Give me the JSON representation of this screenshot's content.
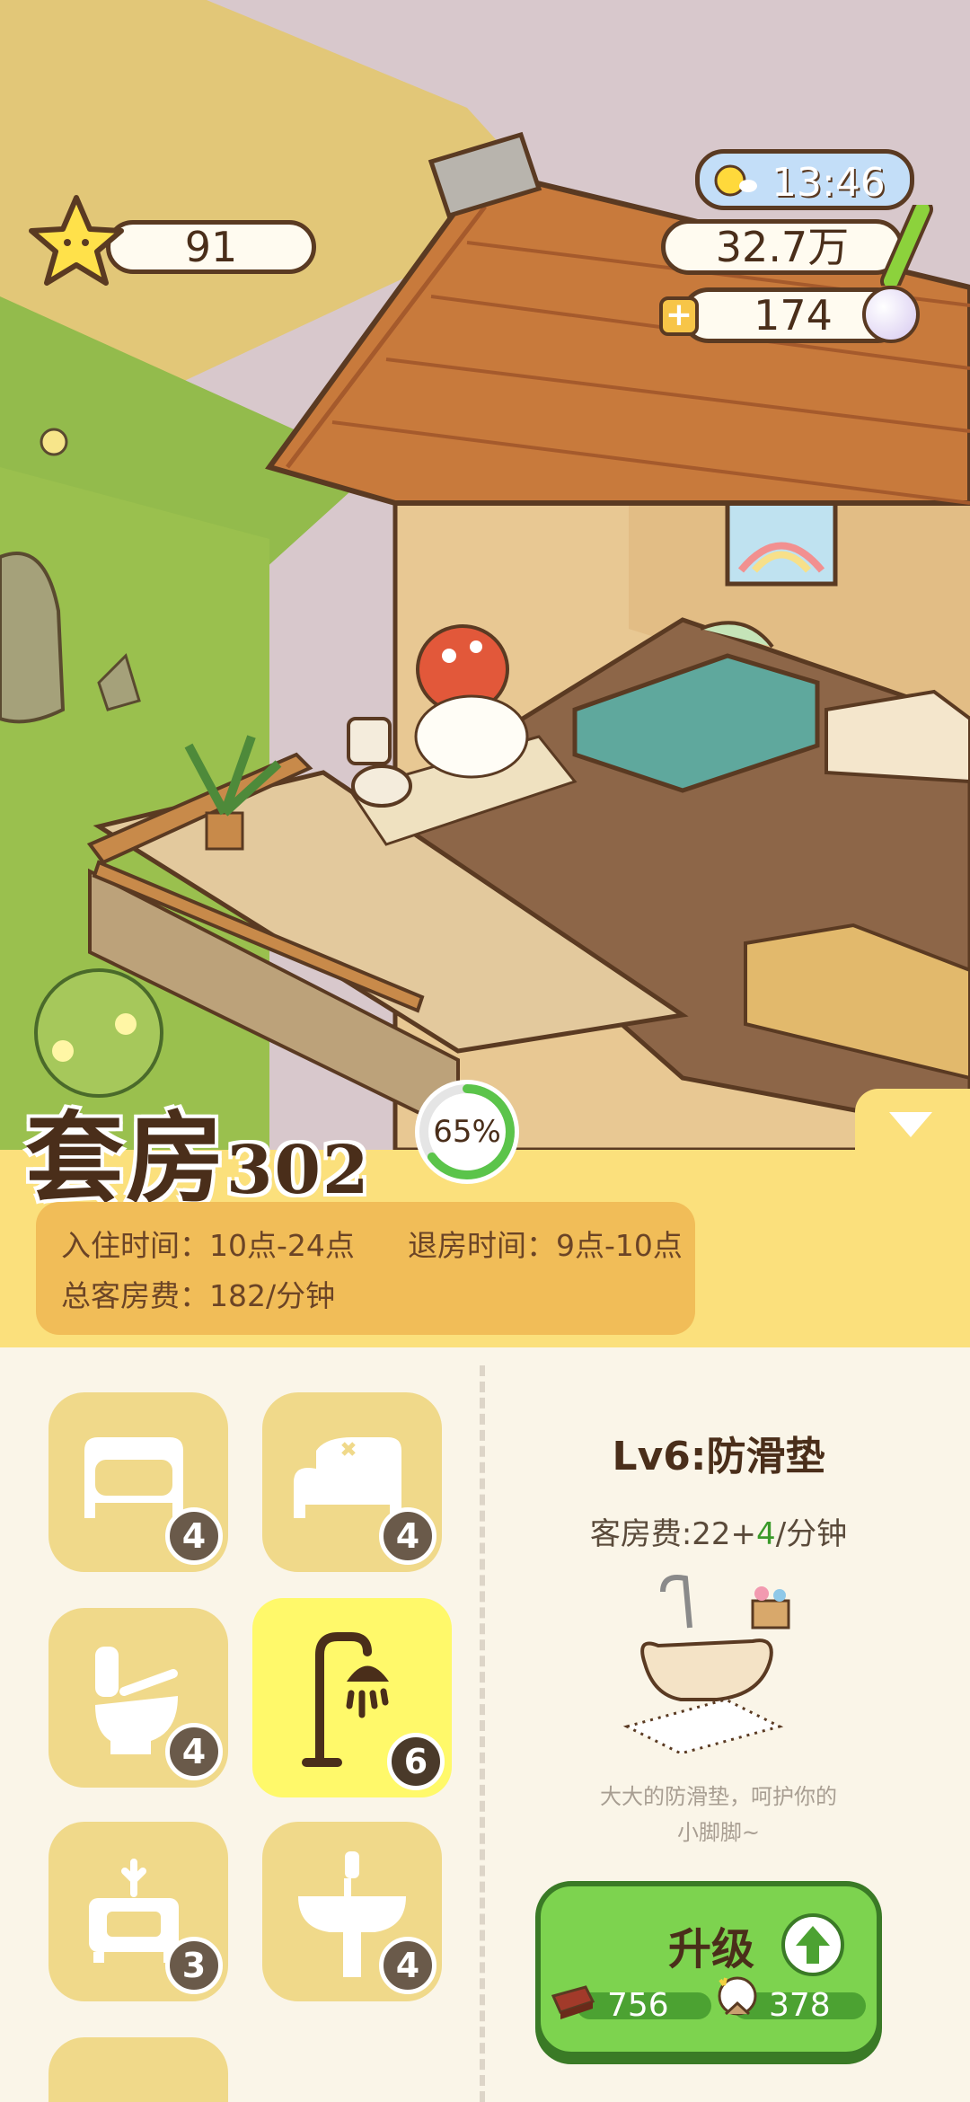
{
  "hud": {
    "weather_time": "13:46",
    "stars": "91",
    "bamboo": "32.7万",
    "pearls": "174"
  },
  "room": {
    "name_main": "套房",
    "name_num": "302",
    "progress_percent": 65,
    "progress_label": "65%",
    "checkin": "入住时间：10点-24点",
    "checkout": "退房时间：9点-10点",
    "total_fee": "总客房费：182/分钟"
  },
  "furniture_tiles": [
    {
      "icon": "bed-icon",
      "level": "4"
    },
    {
      "icon": "sofa-bed-icon",
      "level": "4"
    },
    {
      "icon": "toilet-icon",
      "level": "4"
    },
    {
      "icon": "shower-icon",
      "level": "6",
      "selected": true
    },
    {
      "icon": "nightstand-icon",
      "level": "3"
    },
    {
      "icon": "sink-icon",
      "level": "4"
    }
  ],
  "detail": {
    "title": "Lv6:防滑垫",
    "fee_prefix": "客房费:22+",
    "fee_plus": "4",
    "fee_suffix": "/分钟",
    "desc_line1": "大大的防滑垫，呵护你的",
    "desc_line2": "小脚脚~"
  },
  "upgrade": {
    "label": "升级",
    "wood_cost": "756",
    "cotton_cost": "378"
  },
  "colors": {
    "panel_yellow": "#fbe07c",
    "info_orange": "#f1bd58",
    "tile": "#f0d98a",
    "tile_selected": "#fff96a",
    "button_green": "#7dd34f"
  }
}
